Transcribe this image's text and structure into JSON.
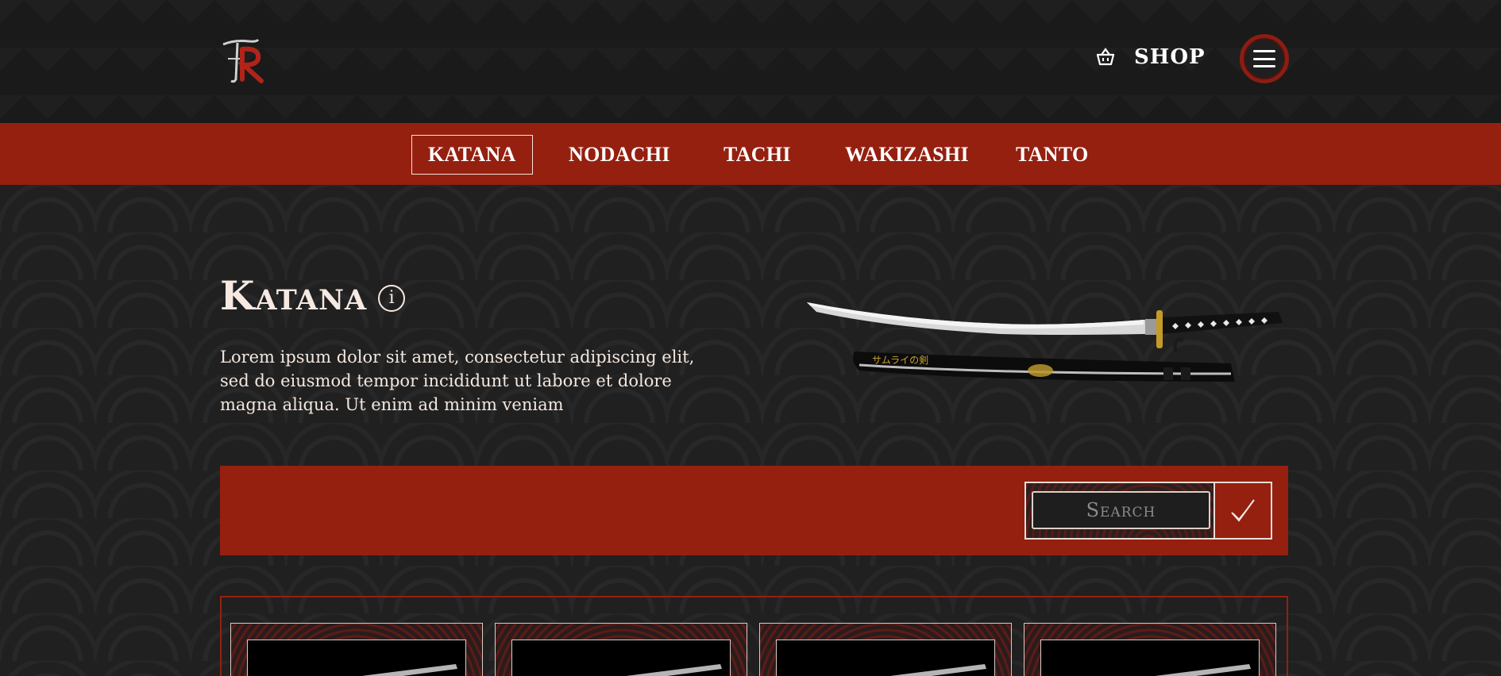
{
  "header": {
    "logo_alt": "TR",
    "shop_label": "SHOP",
    "basket_icon": "basket-icon",
    "menu_icon": "hamburger-menu-icon"
  },
  "nav": {
    "tabs": [
      {
        "label": "KATANA",
        "active": true
      },
      {
        "label": "NODACHI",
        "active": false
      },
      {
        "label": "TACHI",
        "active": false
      },
      {
        "label": "WAKIZASHI",
        "active": false
      },
      {
        "label": "TANTO",
        "active": false
      }
    ]
  },
  "hero": {
    "title": "Katana",
    "info_icon": "i",
    "description": "Lorem ipsum dolor sit amet, consectetur adipiscing elit, sed do eiusmod tempor incididunt ut labore et dolore magna aliqua. Ut enim ad minim veniam",
    "scabbard_text": "サムライの剣"
  },
  "search": {
    "placeholder": "Search",
    "submit_icon": "checkmark-icon"
  },
  "products": {
    "count_visible": 4
  },
  "colors": {
    "accent": "#952010",
    "background": "#1e1e1e",
    "text": "#f2e6dc"
  }
}
